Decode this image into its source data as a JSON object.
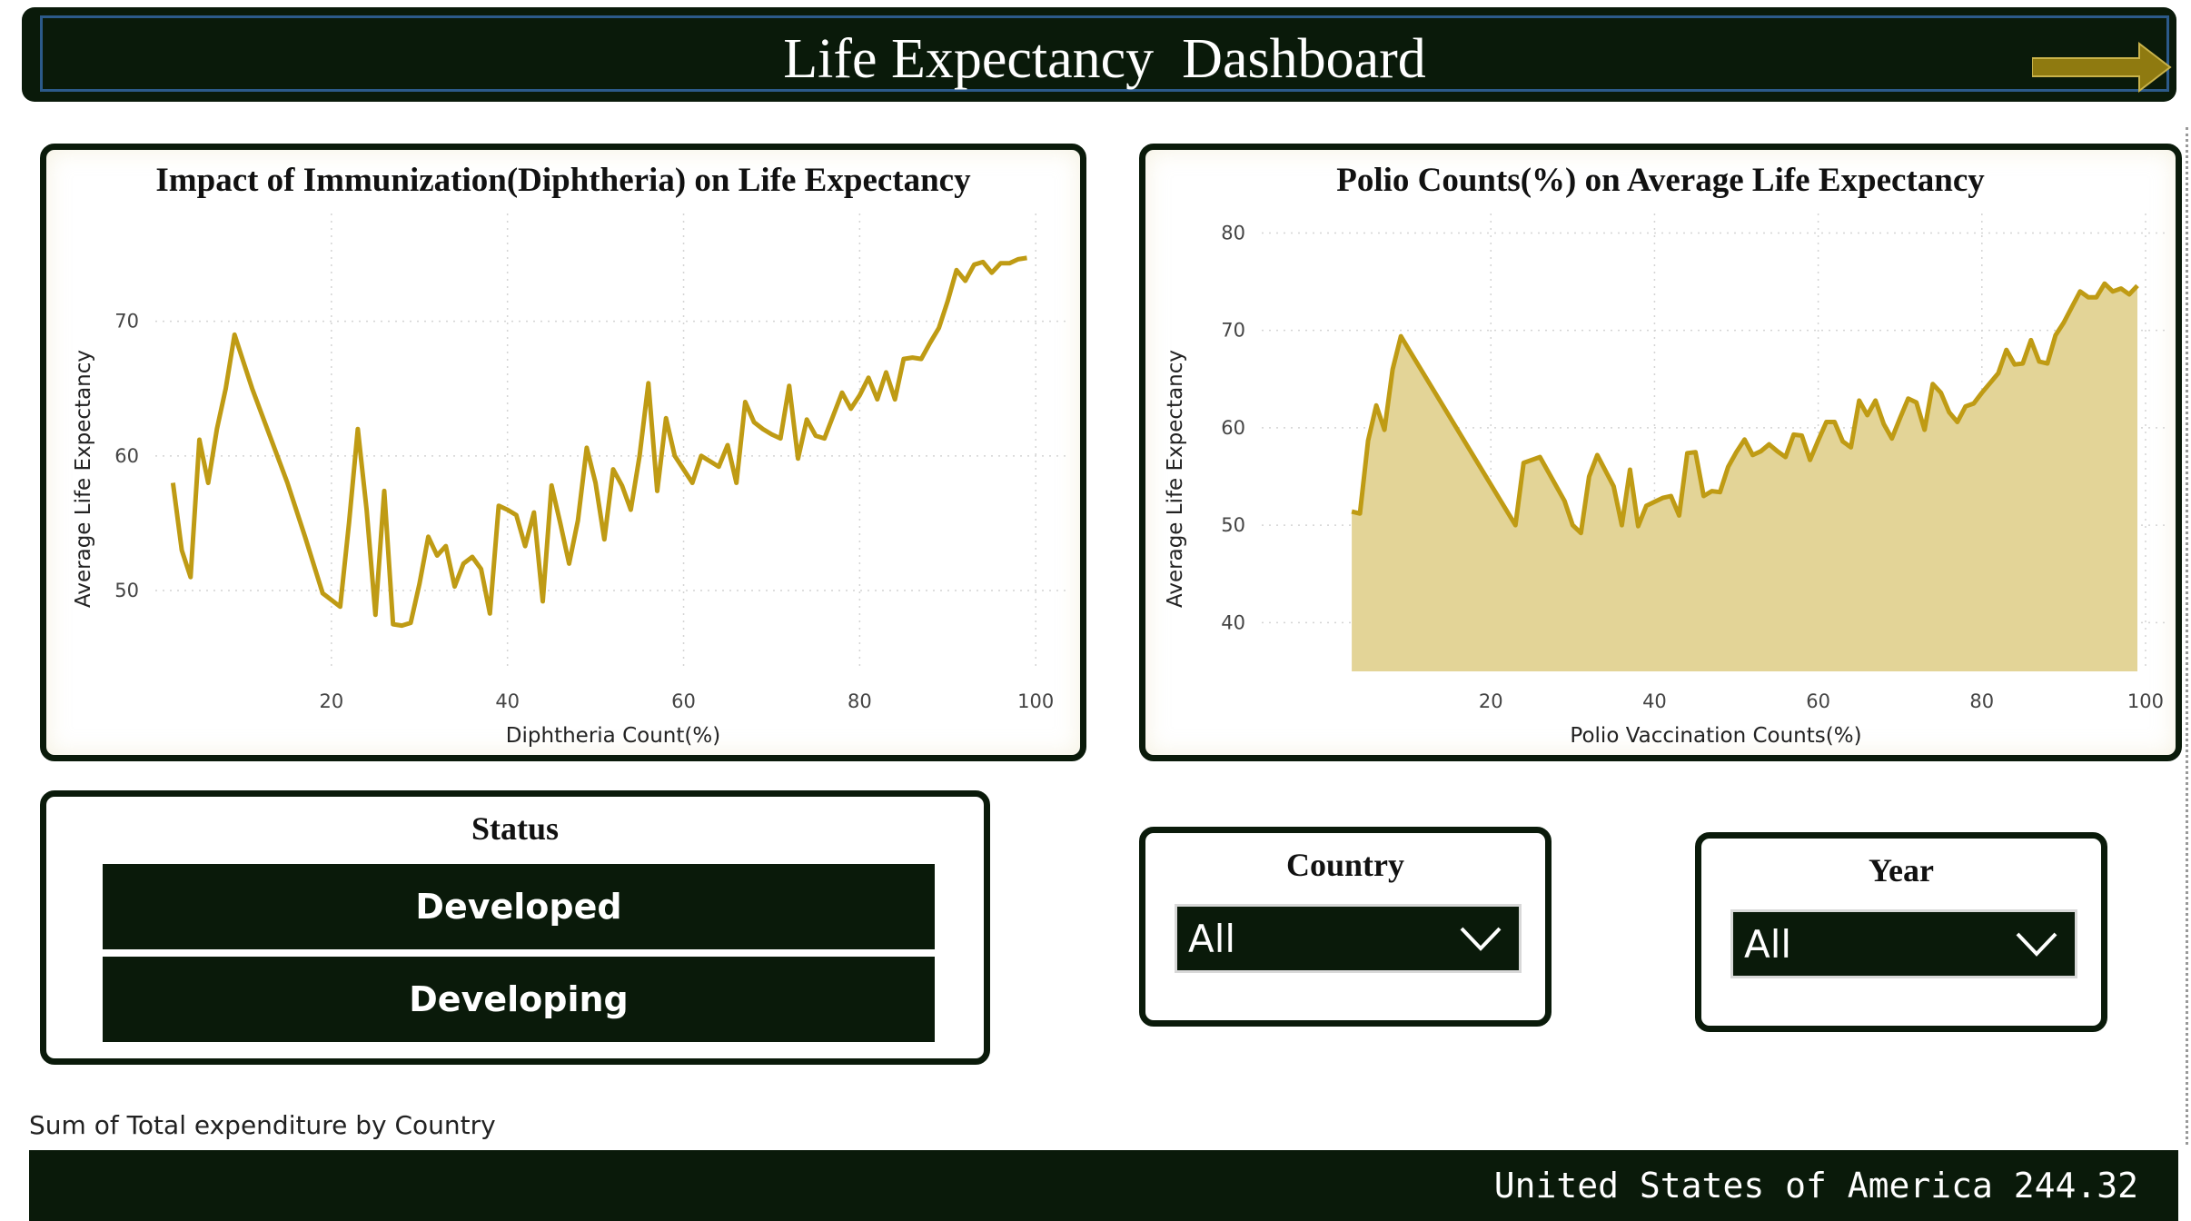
{
  "header": {
    "title": "Life Expectancy  Dashboard",
    "arrow_icon": "right-arrow-icon",
    "arrow_color": "#8f7a10"
  },
  "colors": {
    "dark": "#0a1a0a",
    "series": "#bf9b14",
    "area_fill": "#e3d497"
  },
  "chart_data": [
    {
      "type": "line",
      "title": "Impact of Immunization(Diphtheria) on Life Expectancy",
      "xlabel": "Diphtheria Count(%)",
      "ylabel": "Average Life Expectancy",
      "xlim": [
        0,
        104
      ],
      "ylim": [
        44,
        78
      ],
      "xticks": [
        20,
        40,
        60,
        80,
        100
      ],
      "yticks": [
        50,
        60,
        70
      ],
      "grid": true,
      "series": [
        {
          "x": [
            2,
            3,
            4,
            5,
            6,
            7,
            8,
            9,
            10,
            11,
            13,
            15,
            17,
            19,
            21,
            22,
            23,
            24,
            25,
            26,
            27,
            28,
            29,
            30,
            31,
            32,
            33,
            34,
            35,
            36,
            37,
            38,
            39,
            40,
            41,
            42,
            43,
            44,
            45,
            46,
            47,
            48,
            49,
            50,
            51,
            52,
            53,
            54,
            55,
            56,
            57,
            58,
            59,
            60,
            61,
            62,
            63,
            64,
            65,
            66,
            67,
            68,
            69,
            70,
            71,
            72,
            73,
            74,
            75,
            76,
            77,
            78,
            79,
            80,
            81,
            82,
            83,
            84,
            85,
            86,
            87,
            88,
            89,
            90,
            91,
            92,
            93,
            94,
            95,
            96,
            97,
            98,
            99
          ],
          "y": [
            58.0,
            53.0,
            51.0,
            61.2,
            58.0,
            62.0,
            65.0,
            69.0,
            67.0,
            65.0,
            61.5,
            58.0,
            54.0,
            49.8,
            48.8,
            55.0,
            62.0,
            56.0,
            48.2,
            57.4,
            47.5,
            47.4,
            47.6,
            50.5,
            54.0,
            52.6,
            53.3,
            50.3,
            52.0,
            52.5,
            51.6,
            48.3,
            56.3,
            56.0,
            55.6,
            53.3,
            55.8,
            49.2,
            57.8,
            55.0,
            52.0,
            55.2,
            60.6,
            58.0,
            53.8,
            59.0,
            57.8,
            56.0,
            60.0,
            65.4,
            57.4,
            62.8,
            60.0,
            59.0,
            58.0,
            60.0,
            59.6,
            59.2,
            60.8,
            58.0,
            64.0,
            62.5,
            62.0,
            61.6,
            61.3,
            65.2,
            59.8,
            62.7,
            61.5,
            61.3,
            63.0,
            64.7,
            63.5,
            64.5,
            65.8,
            64.2,
            66.2,
            64.2,
            67.2,
            67.3,
            67.2,
            68.4,
            69.5,
            71.5,
            73.8,
            73.0,
            74.2,
            74.4,
            73.6,
            74.3,
            74.3,
            74.6,
            74.7
          ]
        }
      ]
    },
    {
      "type": "area",
      "title": "Polio Counts(%) on Average Life Expectancy",
      "xlabel": "Polio Vaccination Counts(%)",
      "ylabel": "Average Life Expectancy",
      "xlim": [
        -8,
        103
      ],
      "ylim": [
        35,
        82
      ],
      "xticks": [
        20,
        40,
        60,
        80,
        100
      ],
      "yticks": [
        40,
        50,
        60,
        70,
        80
      ],
      "grid": true,
      "series": [
        {
          "x": [
            3,
            4,
            5,
            6,
            7,
            8,
            9,
            10,
            23,
            24,
            26,
            29,
            30,
            31,
            32,
            33,
            34,
            35,
            36,
            37,
            38,
            39,
            40,
            41,
            42,
            43,
            44,
            45,
            46,
            47,
            48,
            49,
            50,
            51,
            52,
            53,
            54,
            55,
            56,
            57,
            58,
            59,
            60,
            61,
            62,
            63,
            64,
            65,
            66,
            67,
            68,
            69,
            70,
            71,
            72,
            73,
            74,
            75,
            76,
            77,
            78,
            79,
            80,
            81,
            82,
            83,
            84,
            85,
            86,
            87,
            88,
            89,
            90,
            91,
            92,
            93,
            94,
            95,
            96,
            97,
            98,
            99
          ],
          "y": [
            51.4,
            51.2,
            58.7,
            62.3,
            59.8,
            66.0,
            69.4,
            68.0,
            50.0,
            56.4,
            57.0,
            52.5,
            50.0,
            49.2,
            55.0,
            57.2,
            55.6,
            54.0,
            50.0,
            55.7,
            49.9,
            52.0,
            52.4,
            52.8,
            53.0,
            51.0,
            57.4,
            57.5,
            53.0,
            53.5,
            53.4,
            56.0,
            57.5,
            58.8,
            57.2,
            57.6,
            58.3,
            57.6,
            57.0,
            59.3,
            59.2,
            56.7,
            58.7,
            60.6,
            60.6,
            58.6,
            58.0,
            62.8,
            61.3,
            62.8,
            60.4,
            58.9,
            61.0,
            63.0,
            62.6,
            59.8,
            64.5,
            63.6,
            61.6,
            60.6,
            62.2,
            62.5,
            63.6,
            64.6,
            65.6,
            68.0,
            66.5,
            66.6,
            69.0,
            66.8,
            66.6,
            69.5,
            70.8,
            72.4,
            74.0,
            73.4,
            73.4,
            74.8,
            74.0,
            74.3,
            73.7,
            74.6
          ]
        }
      ]
    }
  ],
  "status": {
    "title": "Status",
    "options": [
      "Developed",
      "Developing"
    ]
  },
  "country": {
    "title": "Country",
    "value": "All",
    "icon": "chevron-down-icon"
  },
  "year": {
    "title": "Year",
    "value": "All",
    "icon": "chevron-down-icon"
  },
  "footer": {
    "label": "Sum of Total expenditure by Country",
    "value": "United States of America 244.32"
  }
}
